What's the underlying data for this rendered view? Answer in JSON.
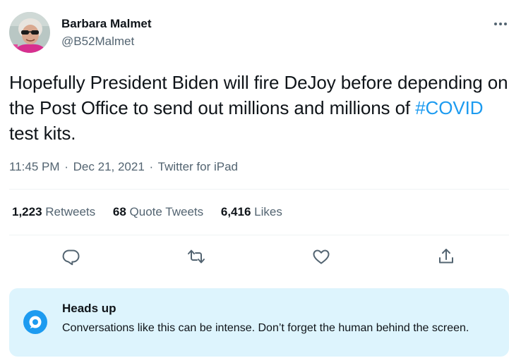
{
  "author": {
    "display_name": "Barbara Malmet",
    "handle": "@B52Malmet"
  },
  "tweet": {
    "text_before": "Hopefully President Biden will fire DeJoy before depending on the Post Office to send out millions and millions of ",
    "hashtag": "#COVID",
    "text_after": " test kits.",
    "time": "11:45 PM",
    "date": "Dec 21, 2021",
    "source": "Twitter for iPad",
    "separator": "·"
  },
  "stats": {
    "retweets": {
      "count": "1,223",
      "label": "Retweets"
    },
    "quotes": {
      "count": "68",
      "label": "Quote Tweets"
    },
    "likes": {
      "count": "6,416",
      "label": "Likes"
    }
  },
  "actions": [
    "reply-icon",
    "retweet-icon",
    "like-icon",
    "share-icon"
  ],
  "heads_up": {
    "title": "Heads up",
    "body": "Conversations like this can be intense. Don’t forget the human behind the screen."
  },
  "colors": {
    "text": "#0f1419",
    "secondary": "#536471",
    "accent": "#1d9bf0",
    "notice_bg": "#ddf4fd",
    "divider": "#eff3f4"
  }
}
